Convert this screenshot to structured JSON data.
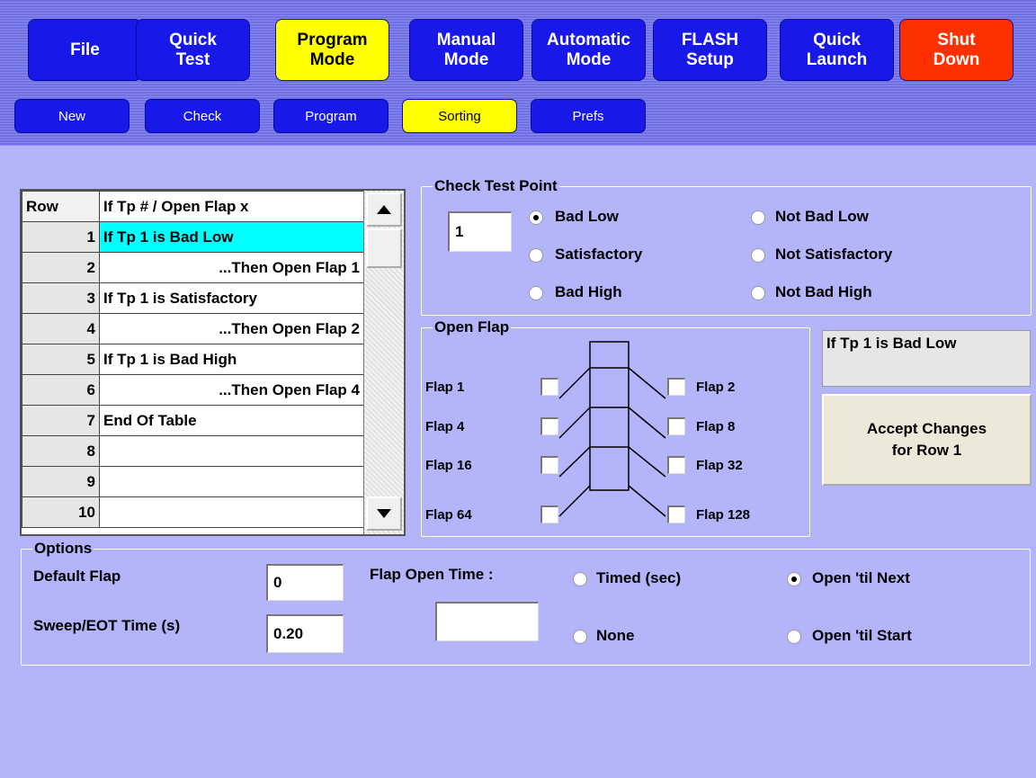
{
  "nav": {
    "items": [
      {
        "label": "File"
      },
      {
        "label": "Quick\nTest"
      },
      {
        "label": "Program\nMode"
      },
      {
        "label": "Manual\nMode"
      },
      {
        "label": "Automatic\nMode"
      },
      {
        "label": "FLASH\nSetup"
      },
      {
        "label": "Quick\nLaunch"
      },
      {
        "label": "Shut\nDown"
      }
    ],
    "active": "Program Mode"
  },
  "subnav": {
    "items": [
      {
        "label": "New"
      },
      {
        "label": "Check"
      },
      {
        "label": "Program"
      },
      {
        "label": "Sorting"
      },
      {
        "label": "Prefs"
      }
    ],
    "active": "Sorting"
  },
  "table": {
    "headers": [
      "Row",
      "If Tp # / Open Flap x"
    ],
    "rows": [
      {
        "num": "1",
        "text": "If Tp 1 is Bad Low"
      },
      {
        "num": "2",
        "text": "...Then Open Flap 1"
      },
      {
        "num": "3",
        "text": "If Tp 1 is Satisfactory"
      },
      {
        "num": "4",
        "text": "...Then Open Flap 2"
      },
      {
        "num": "5",
        "text": "If Tp 1 is Bad High"
      },
      {
        "num": "6",
        "text": "...Then Open Flap 4"
      },
      {
        "num": "7",
        "text": "End Of Table"
      },
      {
        "num": "8",
        "text": ""
      },
      {
        "num": "9",
        "text": ""
      },
      {
        "num": "10",
        "text": ""
      }
    ],
    "selected_row": "1"
  },
  "check_test_point": {
    "title": "Check Test Point",
    "value": "1",
    "options": [
      {
        "label": "Bad Low",
        "selected": true
      },
      {
        "label": "Not Bad Low",
        "selected": false
      },
      {
        "label": "Satisfactory",
        "selected": false
      },
      {
        "label": "Not Satisfactory",
        "selected": false
      },
      {
        "label": "Bad High",
        "selected": false
      },
      {
        "label": "Not Bad High",
        "selected": false
      }
    ]
  },
  "open_flap": {
    "title": "Open Flap",
    "flaps": [
      {
        "label": "Flap 1",
        "checked": false
      },
      {
        "label": "Flap 2",
        "checked": false
      },
      {
        "label": "Flap 4",
        "checked": false
      },
      {
        "label": "Flap 8",
        "checked": false
      },
      {
        "label": "Flap 16",
        "checked": false
      },
      {
        "label": "Flap 32",
        "checked": false
      },
      {
        "label": "Flap 64",
        "checked": false
      },
      {
        "label": "Flap 128",
        "checked": false
      }
    ]
  },
  "status_text": "If Tp 1 is Bad Low",
  "accept_button": "Accept Changes\nfor Row 1",
  "options": {
    "title": "Options",
    "default_flap_label": "Default Flap",
    "default_flap_value": "0",
    "sweep_label": "Sweep/EOT Time (s)",
    "sweep_value": "0.20",
    "flap_open_time_label": "Flap Open Time :",
    "flap_open_time_value": "",
    "modes": [
      {
        "label": "Timed (sec)",
        "selected": false
      },
      {
        "label": "Open 'til Next",
        "selected": true
      },
      {
        "label": "None",
        "selected": false
      },
      {
        "label": "Open 'til Start",
        "selected": false
      }
    ]
  },
  "colors": {
    "background": "#b4b4fa",
    "nav_button": "#1818e8",
    "active": "#ffff00",
    "shutdown": "#ff3000",
    "selected_row": "#00ffff"
  }
}
